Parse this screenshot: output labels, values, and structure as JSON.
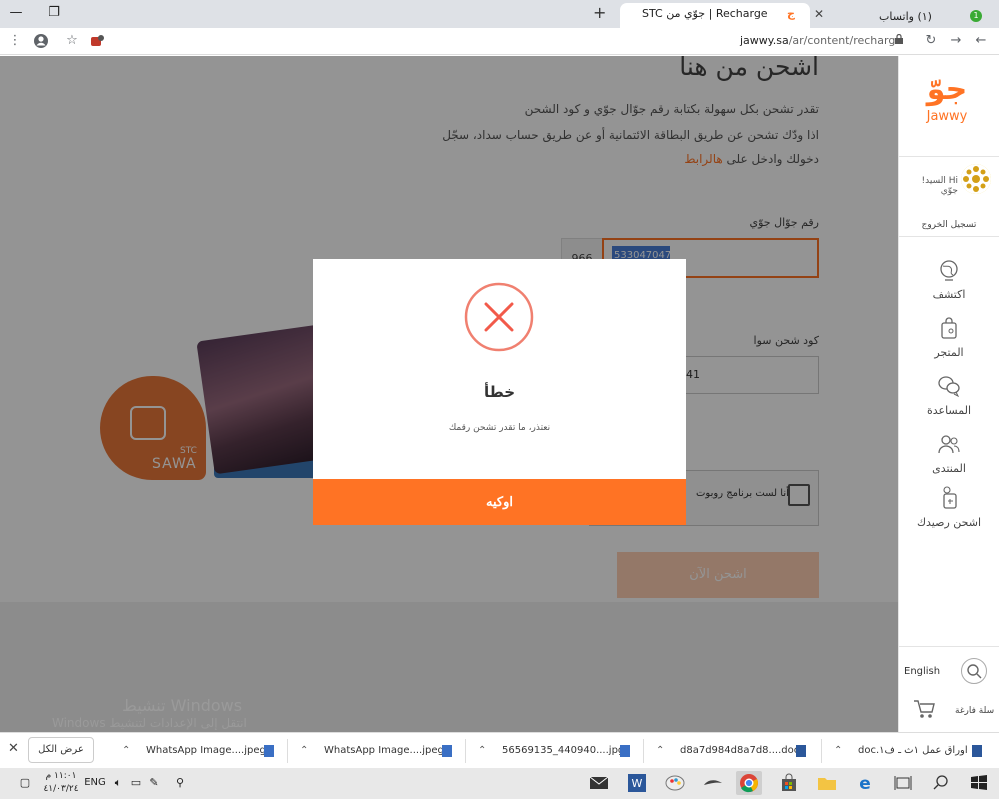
{
  "browser": {
    "tabs": [
      {
        "title": "(١) واتساب",
        "badge": "1",
        "active": false
      },
      {
        "title": "Recharge | جوّي من STC",
        "favicon": "ج",
        "active": true
      }
    ],
    "new_tab": "+",
    "url_domain": "jawwy.sa",
    "url_path": "/ar/content/recharge"
  },
  "page": {
    "heading": "اشحن من هنا",
    "intro_line1": "تقدر تشحن بكل سهولة بكتابة رقم جوّال جوّي و كود الشحن",
    "intro_line2": "اذا ودّك تشحن عن طريق البطاقة الائتمانية أو عن طريق حساب سداد، سجّل",
    "intro_line3": "دخولك وادخل على",
    "intro_link": "هالرابط",
    "phone_label": "رقم جوّال جوّي",
    "phone_prefix": "966",
    "phone_value": "533047047",
    "code_label": "كود شحن سوا",
    "code_value": "41",
    "captcha_text": "أنا لست برنامج روبوت",
    "submit_label": "اشحن الآن",
    "sawa_brand": "SAWA",
    "stc_brand": "STC"
  },
  "sidebar": {
    "logo_text": "Jawwy",
    "logo_mark": "جوّ",
    "user_greeting": "Hi السيد! جوّي",
    "logout": "تسجيل الخروج",
    "items": [
      {
        "label": "اكتشف",
        "icon": "globe-icon"
      },
      {
        "label": "المتجر",
        "icon": "shopping-bag-icon"
      },
      {
        "label": "المساعدة",
        "icon": "chat-bubbles-icon"
      },
      {
        "label": "المنتدى",
        "icon": "users-icon"
      },
      {
        "label": "اشحن رصيدك",
        "icon": "recharge-icon"
      }
    ],
    "language": "English",
    "cart_label": "سلة فارغة"
  },
  "modal": {
    "title": "خطأ",
    "message": "نعتذر، ما تقدر تشحن رقمك",
    "ok_label": "اوكيه",
    "icon": "error-x-icon",
    "accent": "#ff7324"
  },
  "windows_watermark": {
    "title": "تنشيط Windows",
    "subtitle": "انتقل إلى الإعدادات لتنشيط Windows"
  },
  "downloads": {
    "show_all": "عرض الكل",
    "items": [
      {
        "name": "WhatsApp Image....jpeg"
      },
      {
        "name": "WhatsApp Image....jpeg"
      },
      {
        "name": "56569135_440940....jpg"
      },
      {
        "name": "d8a7d984d8a7d8....doc"
      },
      {
        "name": "اوراق عمل ١ث ـ ف١.doc"
      }
    ]
  },
  "taskbar": {
    "time": "١١:٠١ م",
    "date": "٤١/٠٣/٢٤",
    "language": "ENG"
  }
}
